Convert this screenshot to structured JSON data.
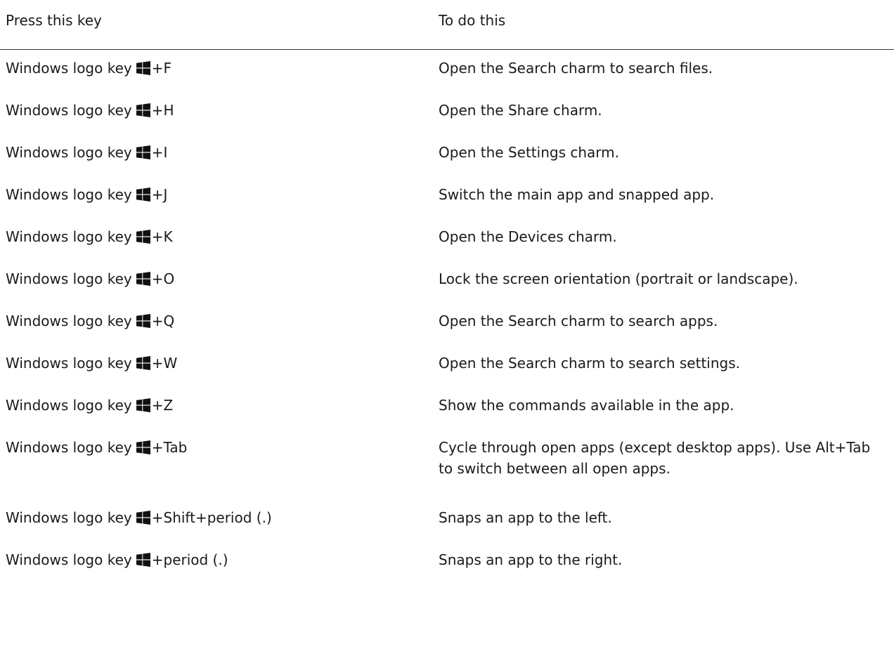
{
  "header": {
    "key_column": "Press this key",
    "action_column": "To do this"
  },
  "icons": {
    "key_icon": "windows-logo-icon"
  },
  "rows": [
    {
      "prefix": "Windows logo key",
      "suffix": "+F",
      "action": "Open the Search charm to search files."
    },
    {
      "prefix": "Windows logo key",
      "suffix": "+H",
      "action": "Open the Share charm."
    },
    {
      "prefix": "Windows logo key",
      "suffix": "+I",
      "action": "Open the Settings charm."
    },
    {
      "prefix": "Windows logo key",
      "suffix": "+J",
      "action": "Switch the main app and snapped app."
    },
    {
      "prefix": "Windows logo key",
      "suffix": "+K",
      "action": "Open the Devices charm."
    },
    {
      "prefix": "Windows logo key",
      "suffix": "+O",
      "action": "Lock the screen orientation (portrait or landscape)."
    },
    {
      "prefix": "Windows logo key",
      "suffix": "+Q",
      "action": "Open the Search charm to search apps."
    },
    {
      "prefix": "Windows logo key",
      "suffix": "+W",
      "action": "Open the Search charm to search settings."
    },
    {
      "prefix": "Windows logo key",
      "suffix": "+Z",
      "action": "Show the commands available in the app."
    },
    {
      "prefix": "Windows logo key",
      "suffix": "+Tab",
      "action": "Cycle through open apps (except desktop apps). Use Alt+Tab to switch between all open apps."
    },
    {
      "prefix": "Windows logo key",
      "suffix": "+Shift+period (.)",
      "action": "Snaps an app to the left."
    },
    {
      "prefix": "Windows logo key",
      "suffix": "+period (.)",
      "action": "Snaps an app to the right."
    }
  ]
}
